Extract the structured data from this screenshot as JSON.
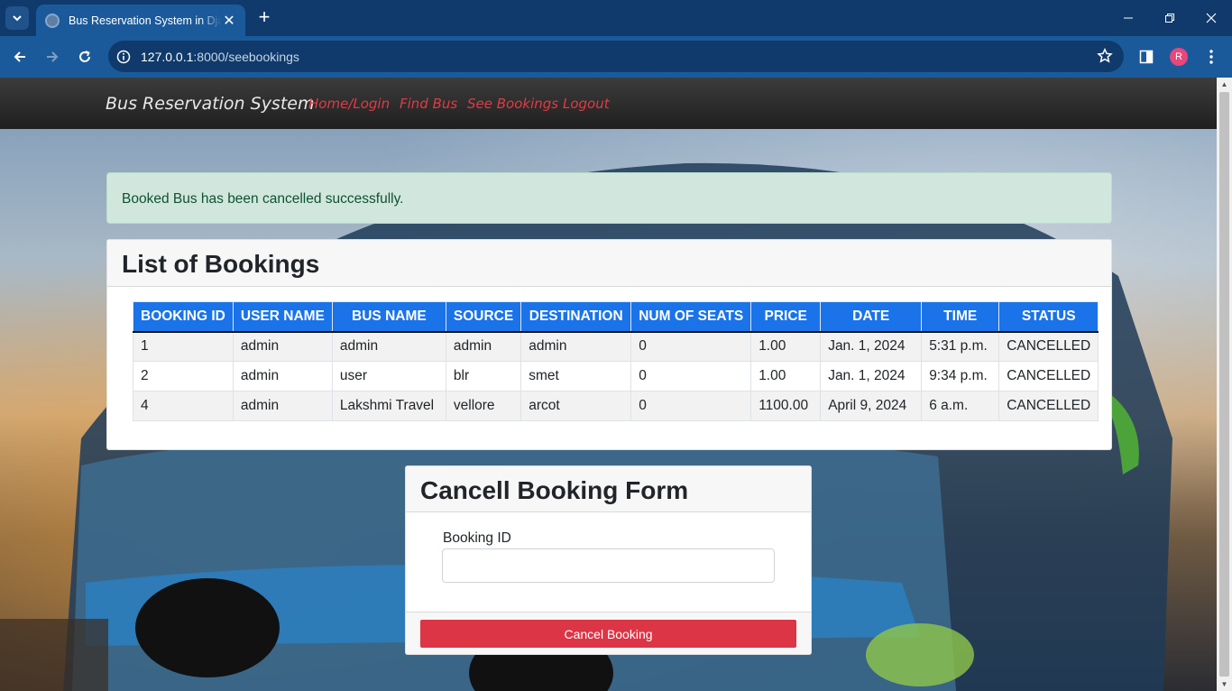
{
  "browser": {
    "tab_title": "Bus Reservation System in Django",
    "url_host": "127.0.0.1",
    "url_path": ":8000/seebookings",
    "profile_initial": "R"
  },
  "nav": {
    "brand": "Bus Reservation System",
    "links": [
      "Home/Login",
      "Find Bus",
      "See Bookings",
      "Logout"
    ]
  },
  "alert": "Booked Bus has been cancelled successfully.",
  "bookings": {
    "title": "List of Bookings",
    "columns": [
      "BOOKING ID",
      "USER NAME",
      "BUS NAME",
      "SOURCE",
      "DESTINATION",
      "NUM OF SEATS",
      "PRICE",
      "DATE",
      "TIME",
      "STATUS"
    ],
    "rows": [
      [
        "1",
        "admin",
        "admin",
        "admin",
        "admin",
        "0",
        "1.00",
        "Jan. 1, 2024",
        "5:31 p.m.",
        "CANCELLED"
      ],
      [
        "2",
        "admin",
        "user",
        "blr",
        "smet",
        "0",
        "1.00",
        "Jan. 1, 2024",
        "9:34 p.m.",
        "CANCELLED"
      ],
      [
        "4",
        "admin",
        "Lakshmi Travel",
        "vellore",
        "arcot",
        "0",
        "1100.00",
        "April 9, 2024",
        "6 a.m.",
        "CANCELLED"
      ]
    ]
  },
  "cancel_form": {
    "title": "Cancell Booking Form",
    "label": "Booking ID",
    "value": "",
    "button": "Cancel Booking"
  },
  "colors": {
    "table_header": "#1a73e8",
    "nav_link": "#e33a44",
    "danger": "#dc3545",
    "alert_bg": "#d1e7dd"
  }
}
